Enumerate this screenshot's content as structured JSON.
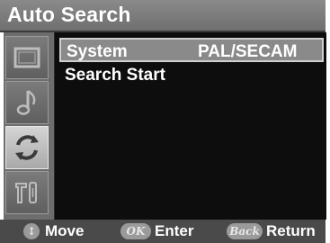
{
  "title": "Auto Search",
  "sidebar": {
    "items": [
      {
        "icon": "picture-icon",
        "active": false
      },
      {
        "icon": "music-note-icon",
        "active": false
      },
      {
        "icon": "refresh-icon",
        "active": true
      },
      {
        "icon": "tools-icon",
        "active": false
      }
    ]
  },
  "menu": {
    "items": [
      {
        "label": "System",
        "value": "PAL/SECAM",
        "selected": true
      },
      {
        "label": "Search Start",
        "value": "",
        "selected": false
      }
    ]
  },
  "footer": {
    "move": {
      "icon_text": "↕",
      "label": "Move"
    },
    "enter": {
      "icon_text": "OK",
      "label": "Enter"
    },
    "return": {
      "icon_text": "Back",
      "label": "Return"
    }
  }
}
